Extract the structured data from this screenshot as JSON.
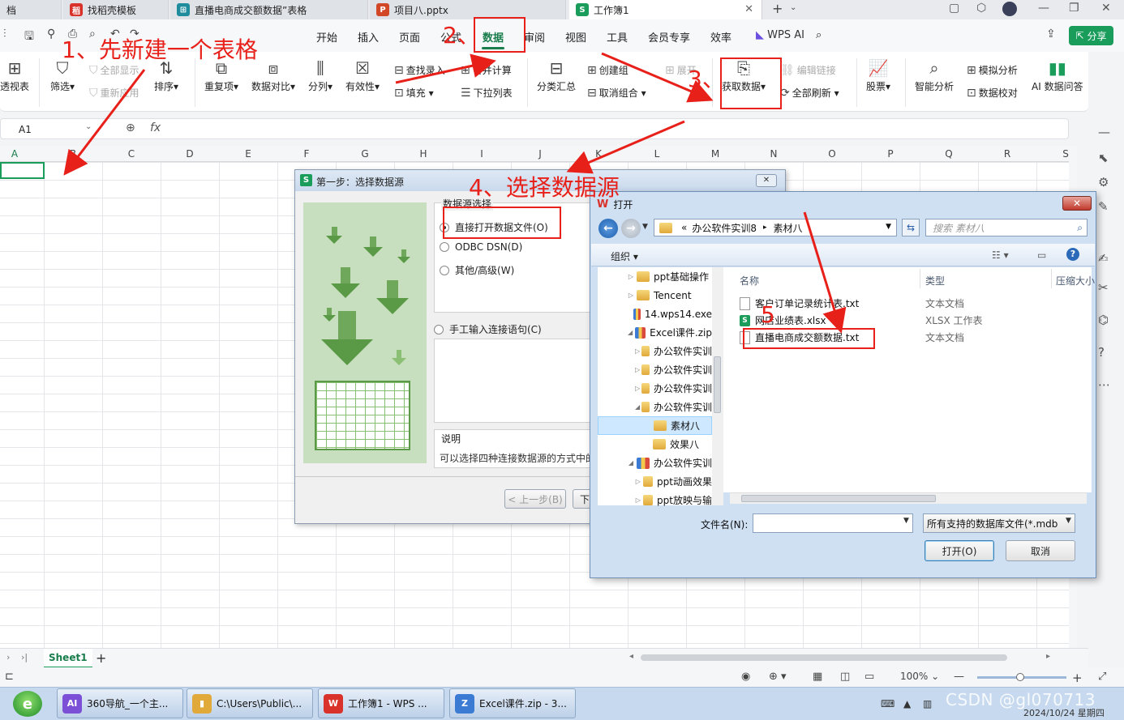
{
  "tabs": [
    {
      "label": "档",
      "icon": "",
      "color": "#888888",
      "active": false
    },
    {
      "label": "找稻壳模板",
      "icon": "稻",
      "color": "#d8322b",
      "active": false
    },
    {
      "label": "直播电商成交额数据”表格",
      "icon": "⊞",
      "color": "#1f8c9e",
      "active": false
    },
    {
      "label": "项目八.pptx",
      "icon": "P",
      "color": "#d24726",
      "active": false
    },
    {
      "label": "工作簿1",
      "icon": "S",
      "color": "#1a9c5b",
      "active": true
    }
  ],
  "menu": {
    "items": [
      "开始",
      "插入",
      "页面",
      "公式",
      "数据",
      "审阅",
      "视图",
      "工具",
      "会员专享",
      "效率"
    ],
    "active": "数据",
    "wps_ai": "WPS AI",
    "share": "分享"
  },
  "ribbon": {
    "pivot": "透视表",
    "filter": "筛选",
    "show_all": "全部显示",
    "reapply": "重新应用",
    "sort": "排序",
    "duplicates": "重复项",
    "compare": "数据对比",
    "split": "分列",
    "validity": "有效性",
    "find_entry": "查找录入",
    "fill": "填充",
    "merge_calc": "合并计算",
    "dropdown_list": "下拉列表",
    "subtotal": "分类汇总",
    "create_group": "创建组",
    "ungroup": "取消组合",
    "expand": "展开",
    "get_data": "获取数据",
    "edit_links": "编辑链接",
    "refresh_all": "全部刷新",
    "stocks": "股票",
    "smart_analysis": "智能分析",
    "simulation": "模拟分析",
    "data_check": "数据校对",
    "ai_qa": "AI 数据问答"
  },
  "formula": {
    "cell_ref": "A1",
    "fx": "fx"
  },
  "columns": [
    "A",
    "B",
    "C",
    "D",
    "E",
    "F",
    "G",
    "H",
    "I",
    "J",
    "K",
    "L",
    "M",
    "N",
    "O",
    "P",
    "Q",
    "R",
    "S"
  ],
  "sheet": {
    "name": "Sheet1",
    "add": "+"
  },
  "status": {
    "zoom": "100%"
  },
  "dialog_step": {
    "title": "第一步：选择数据源",
    "group_label": "数据源选择",
    "options": [
      "直接打开数据文件(O)",
      "ODBC DSN(D)",
      "其他/高级(W)"
    ],
    "selected": 0,
    "manual": "手工输入连接语句(C)",
    "desc_label": "说明",
    "desc_text": "可以选择四种连接数据源的方式中的",
    "prev_btn": "< 上一步(B)",
    "next_btn": "下"
  },
  "dialog_open": {
    "title": "打开",
    "path": [
      "«",
      "办公软件实训8",
      "▸",
      "素材八"
    ],
    "search_placeholder": "搜索 素材八",
    "organize": "组织 ▾",
    "tree": [
      {
        "label": "ppt基础操作",
        "indent": 0,
        "kind": "folder",
        "tri": "▷"
      },
      {
        "label": "Tencent",
        "indent": 0,
        "kind": "folder",
        "tri": "▷"
      },
      {
        "label": "14.wps14.exe",
        "indent": 0,
        "kind": "zip",
        "tri": ""
      },
      {
        "label": "Excel课件.zip",
        "indent": 0,
        "kind": "zip",
        "tri": "◢"
      },
      {
        "label": "办公软件实训",
        "indent": 1,
        "kind": "folder",
        "tri": "▷"
      },
      {
        "label": "办公软件实训",
        "indent": 1,
        "kind": "folder",
        "tri": "▷"
      },
      {
        "label": "办公软件实训",
        "indent": 1,
        "kind": "folder",
        "tri": "▷"
      },
      {
        "label": "办公软件实训",
        "indent": 1,
        "kind": "folder",
        "tri": "◢"
      },
      {
        "label": "素材八",
        "indent": 2,
        "kind": "folder",
        "tri": "",
        "selected": true
      },
      {
        "label": "效果八",
        "indent": 2,
        "kind": "folder",
        "tri": ""
      },
      {
        "label": "办公软件实训",
        "indent": 0,
        "kind": "zip",
        "tri": "◢"
      },
      {
        "label": "ppt动画效果",
        "indent": 1,
        "kind": "folder",
        "tri": "▷"
      },
      {
        "label": "ppt放映与输",
        "indent": 1,
        "kind": "folder",
        "tri": "▷"
      }
    ],
    "col_name": "名称",
    "col_type": "类型",
    "col_size": "压缩大小",
    "files": [
      {
        "name": "客户订单记录统计表.txt",
        "type": "文本文档",
        "kind": "txt"
      },
      {
        "name": "网店业绩表.xlsx",
        "type": "XLSX 工作表",
        "kind": "xlsx"
      },
      {
        "name": "直播电商成交额数据.txt",
        "type": "文本文档",
        "kind": "txt"
      }
    ],
    "filename_label": "文件名(N):",
    "filetype": "所有支持的数据库文件(*.mdb",
    "open_btn": "打开(O)",
    "cancel_btn": "取消"
  },
  "annotations": {
    "a1": "1、先新建一个表格",
    "a2": "2、",
    "a3": "3、",
    "a4": "4、选择数据源",
    "a5": "5"
  },
  "taskbar": {
    "items": [
      {
        "label": "360导航_一个主...",
        "icon": "AI",
        "color": "#7b4fd6"
      },
      {
        "label": "C:\\Users\\Public\\...",
        "icon": "▮",
        "color": "#e0a93a"
      },
      {
        "label": "工作簿1 - WPS ...",
        "icon": "W",
        "color": "#d8322b"
      },
      {
        "label": "Excel课件.zip - 3...",
        "icon": "Z",
        "color": "#3b7bd4"
      }
    ],
    "date": "2024/10/24 星期四",
    "watermark": "CSDN @gl070713"
  }
}
